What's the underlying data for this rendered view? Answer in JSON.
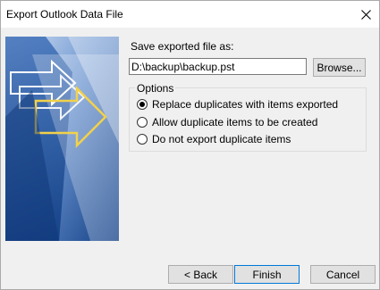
{
  "window": {
    "title": "Export Outlook Data File"
  },
  "save": {
    "label": "Save exported file as:",
    "path_value": "D:\\backup\\backup.pst",
    "browse_label": "Browse..."
  },
  "options": {
    "legend": "Options",
    "items": [
      {
        "label": "Replace duplicates with items exported",
        "checked": true
      },
      {
        "label": "Allow duplicate items to be created",
        "checked": false
      },
      {
        "label": "Do not export duplicate items",
        "checked": false
      }
    ]
  },
  "buttons": {
    "back": "< Back",
    "finish": "Finish",
    "cancel": "Cancel"
  },
  "colors": {
    "banner_blue_dark": "#1b4f9a",
    "banner_blue_light": "#8fb3e0",
    "arrow_yellow": "#f2d14a",
    "focus_blue": "#0078d7"
  },
  "icons": {
    "close": "close-icon"
  }
}
